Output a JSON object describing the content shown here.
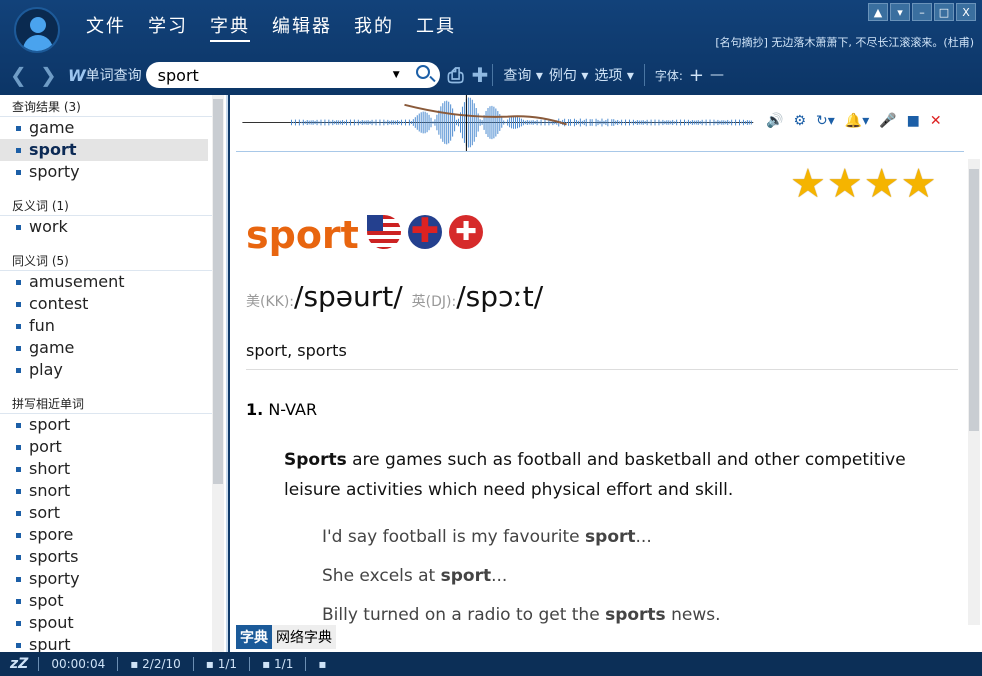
{
  "menu": [
    "文件",
    "学习",
    "字典",
    "编辑器",
    "我的",
    "工具"
  ],
  "window_buttons": [
    "skin",
    "menu",
    "minimize",
    "maximize",
    "X"
  ],
  "quote": "[名句摘抄] 无边落木萧萧下, 不尽长江滚滚来。(杜甫)",
  "toolbar": {
    "w": "W",
    "lookup_label": "单词查询",
    "search_value": "sport",
    "query": "查询 ▾",
    "examples": "例句 ▾",
    "options": "选项 ▾",
    "font": "字体:",
    "font_plus": "+",
    "font_minus": "—"
  },
  "left": {
    "groups": [
      {
        "title": "查询结果 (3)",
        "items": [
          "game",
          "sport",
          "sporty"
        ]
      },
      {
        "title": "反义词 (1)",
        "items": [
          "work"
        ]
      },
      {
        "title": "同义词 (5)",
        "items": [
          "amusement",
          "contest",
          "fun",
          "game",
          "play"
        ]
      },
      {
        "title": "拼写相近单词",
        "items": [
          "sport",
          "port",
          "short",
          "snort",
          "sort",
          "spore",
          "sports",
          "sporty",
          "spot",
          "spout",
          "spurt"
        ]
      }
    ],
    "selected": "sport"
  },
  "entry": {
    "stars": 4,
    "headword": "sport",
    "us_label": "美(KK):",
    "us_ipa": "/spəurt/",
    "uk_label": "英(DJ):",
    "uk_ipa": "/spɔːt/",
    "forms": "sport, sports",
    "sense_num": "1.",
    "sense_pos": "N-VAR",
    "def_bold": "Sports",
    "def_rest": " are games such as football and basketball and other competitive leisure activities which need physical effort and skill.",
    "examples": [
      {
        "pre": "I'd say football is my favourite ",
        "bold": "sport",
        "post": "..."
      },
      {
        "pre": "She excels at ",
        "bold": "sport",
        "post": "..."
      },
      {
        "pre": "Billy turned on a radio to get the ",
        "bold": "sports",
        "post": " news."
      }
    ]
  },
  "bottom_tabs": [
    "字典",
    "网络字典"
  ],
  "status": {
    "sleep": "zZ",
    "time": "00:00:04",
    "a": "▪ 2/2/10",
    "b": "▪ 1/1",
    "c": "▪ 1/1",
    "d": "▪"
  },
  "colors": {
    "headword": "#e8650f",
    "accent": "#1b5a99",
    "stars": "#f5b400"
  }
}
